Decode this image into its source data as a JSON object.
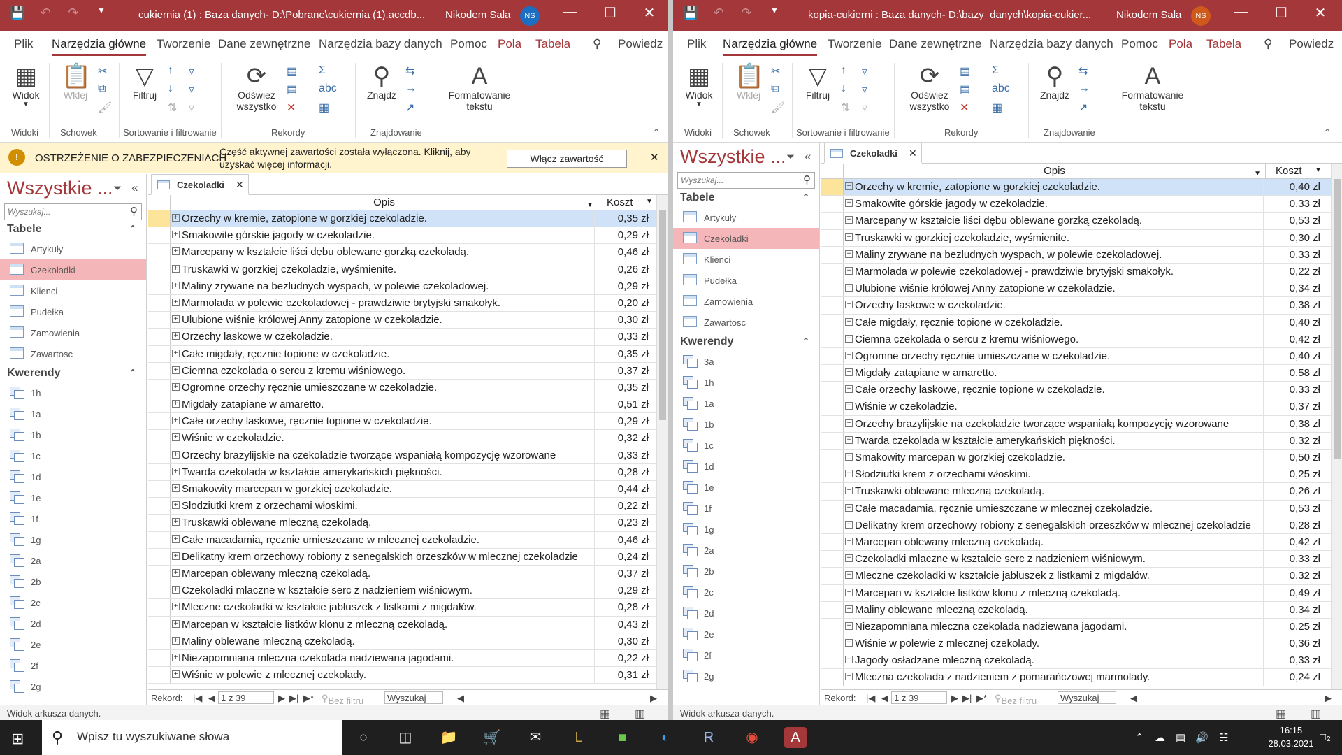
{
  "left": {
    "title": "cukiernia (1) : Baza danych- D:\\Pobrane\\cukiernia (1).accdb...",
    "user": "Nikodem Sala",
    "initials": "NS",
    "record_total": "1 z 39",
    "records": [
      [
        "Orzechy w kremie, zatopione w gorzkiej czekoladzie.",
        "0,35 zł"
      ],
      [
        "Smakowite górskie jagody w czekoladzie.",
        "0,29 zł"
      ],
      [
        "Marcepany w kształcie liści dębu oblewane gorzką czekoladą.",
        "0,46 zł"
      ],
      [
        "Truskawki w gorzkiej czekoladzie, wyśmienite.",
        "0,26 zł"
      ],
      [
        "Maliny zrywane na bezludnych wyspach, w polewie czekoladowej.",
        "0,29 zł"
      ],
      [
        "Marmolada w polewie czekoladowej - prawdziwie brytyjski smakołyk.",
        "0,20 zł"
      ],
      [
        "Ulubione wiśnie królowej Anny zatopione w czekoladzie.",
        "0,30 zł"
      ],
      [
        "Orzechy laskowe w czekoladzie.",
        "0,33 zł"
      ],
      [
        "Całe migdały, ręcznie topione w czekoladzie.",
        "0,35 zł"
      ],
      [
        "Ciemna czekolada o sercu z kremu wiśniowego.",
        "0,37 zł"
      ],
      [
        "Ogromne orzechy ręcznie umieszczane w czekoladzie.",
        "0,35 zł"
      ],
      [
        "Migdały zatapiane w amaretto.",
        "0,51 zł"
      ],
      [
        "Całe orzechy laskowe, ręcznie topione w czekoladzie.",
        "0,29 zł"
      ],
      [
        "Wiśnie w czekoladzie.",
        "0,32 zł"
      ],
      [
        "Orzechy brazylijskie na czekoladzie tworzące wspaniałą kompozycję wzorowane",
        "0,33 zł"
      ],
      [
        "Twarda czekolada w kształcie amerykańskich piękności.",
        "0,28 zł"
      ],
      [
        "Smakowity marcepan w gorzkiej czekoladzie.",
        "0,44 zł"
      ],
      [
        "Słodziutki krem z orzechami włoskimi.",
        "0,22 zł"
      ],
      [
        "Truskawki oblewane mleczną czekoladą.",
        "0,23 zł"
      ],
      [
        "Całe macadamia, ręcznie umieszczane w mlecznej czekoladzie.",
        "0,46 zł"
      ],
      [
        "Delikatny krem orzechowy robiony z senegalskich orzeszków w mlecznej czekoladzie",
        "0,24 zł"
      ],
      [
        "Marcepan oblewany mleczną czekoladą.",
        "0,37 zł"
      ],
      [
        "Czekoladki mlaczne w kształcie serc z nadzieniem wiśniowym.",
        "0,29 zł"
      ],
      [
        "Mleczne czekoladki w kształcie jabłuszek z listkami z migdałów.",
        "0,28 zł"
      ],
      [
        "Marcepan w kształcie listków klonu z mleczną czekoladą.",
        "0,43 zł"
      ],
      [
        "Maliny oblewane mleczną czekoladą.",
        "0,30 zł"
      ],
      [
        "Niezapomniana mleczna czekolada nadziewana jagodami.",
        "0,22 zł"
      ],
      [
        "Wiśnie w polewie z mlecznej czekolady.",
        "0,31 zł"
      ]
    ]
  },
  "right": {
    "title": "kopia-cukierni : Baza danych- D:\\bazy_danych\\kopia-cukier...",
    "user": "Nikodem Sala",
    "initials": "NS",
    "record_total": "1 z 39",
    "records": [
      [
        "Orzechy w kremie, zatopione w gorzkiej czekoladzie.",
        "0,40 zł"
      ],
      [
        "Smakowite górskie jagody w czekoladzie.",
        "0,33 zł"
      ],
      [
        "Marcepany w kształcie liści dębu oblewane gorzką czekoladą.",
        "0,53 zł"
      ],
      [
        "Truskawki w gorzkiej czekoladzie, wyśmienite.",
        "0,30 zł"
      ],
      [
        "Maliny zrywane na bezludnych wyspach, w polewie czekoladowej.",
        "0,33 zł"
      ],
      [
        "Marmolada w polewie czekoladowej - prawdziwie brytyjski smakołyk.",
        "0,22 zł"
      ],
      [
        "Ulubione wiśnie królowej Anny zatopione w czekoladzie.",
        "0,34 zł"
      ],
      [
        "Orzechy laskowe w czekoladzie.",
        "0,38 zł"
      ],
      [
        "Całe migdały, ręcznie topione w czekoladzie.",
        "0,40 zł"
      ],
      [
        "Ciemna czekolada o sercu z kremu wiśniowego.",
        "0,42 zł"
      ],
      [
        "Ogromne orzechy ręcznie umieszczane w czekoladzie.",
        "0,40 zł"
      ],
      [
        "Migdały zatapiane w amaretto.",
        "0,58 zł"
      ],
      [
        "Całe orzechy laskowe, ręcznie topione w czekoladzie.",
        "0,33 zł"
      ],
      [
        "Wiśnie w czekoladzie.",
        "0,37 zł"
      ],
      [
        "Orzechy brazylijskie na czekoladzie tworzące wspaniałą kompozycję wzorowane",
        "0,38 zł"
      ],
      [
        "Twarda czekolada w kształcie amerykańskich piękności.",
        "0,32 zł"
      ],
      [
        "Smakowity marcepan w gorzkiej czekoladzie.",
        "0,50 zł"
      ],
      [
        "Słodziutki krem z orzechami włoskimi.",
        "0,25 zł"
      ],
      [
        "Truskawki oblewane mleczną czekoladą.",
        "0,26 zł"
      ],
      [
        "Całe macadamia, ręcznie umieszczane w mlecznej czekoladzie.",
        "0,53 zł"
      ],
      [
        "Delikatny krem orzechowy robiony z senegalskich orzeszków w mlecznej czekoladzie",
        "0,28 zł"
      ],
      [
        "Marcepan oblewany mleczną czekoladą.",
        "0,42 zł"
      ],
      [
        "Czekoladki mlaczne w kształcie serc z nadzieniem wiśniowym.",
        "0,33 zł"
      ],
      [
        "Mleczne czekoladki w kształcie jabłuszek z listkami z migdałów.",
        "0,32 zł"
      ],
      [
        "Marcepan w kształcie listków klonu z mleczną czekoladą.",
        "0,49 zł"
      ],
      [
        "Maliny oblewane mleczną czekoladą.",
        "0,34 zł"
      ],
      [
        "Niezapomniana mleczna czekolada nadziewana jagodami.",
        "0,25 zł"
      ],
      [
        "Wiśnie w polewie z mlecznej czekolady.",
        "0,36 zł"
      ],
      [
        "Jagody osładzane mleczną czekoladą.",
        "0,33 zł"
      ],
      [
        "Mleczna czekolada z nadzieniem z pomarańczowej marmolady.",
        "0,24 zł"
      ]
    ]
  },
  "ribbon_tabs": [
    "Plik",
    "Narzędzia główne",
    "Tworzenie",
    "Dane zewnętrzne",
    "Narzędzia bazy danych",
    "Pomoc",
    "Pola",
    "Tabela",
    "Powiedz"
  ],
  "ribbon": {
    "widok": "Widok",
    "wklej": "Wklej",
    "filtruj": "Filtruj",
    "odswiez_1": "Odśwież",
    "odswiez_2": "wszystko",
    "znajdz": "Znajdź",
    "format_1": "Formatowanie",
    "format_2": "tekstu",
    "groups": [
      "Widoki",
      "Schowek",
      "Sortowanie i filtrowanie",
      "Rekordy",
      "Znajdowanie"
    ]
  },
  "warning": {
    "title": "OSTRZEŻENIE O ZABEZPIECZENIACH",
    "message": "Część aktywnej zawartości została wyłączona. Kliknij, aby uzyskać więcej informacji.",
    "button": "Włącz zawartość"
  },
  "nav": {
    "title": "Wszystkie ...",
    "search_placeholder": "Wyszukaj...",
    "tables_header": "Tabele",
    "queries_header": "Kwerendy",
    "tables": [
      "Artykuły",
      "Czekoladki",
      "Klienci",
      "Pudełka",
      "Zamowienia",
      "Zawartosc"
    ],
    "queries_left": [
      "1h",
      "1a",
      "1b",
      "1c",
      "1d",
      "1e",
      "1f",
      "1g",
      "2a",
      "2b",
      "2c",
      "2d",
      "2e",
      "2f",
      "2g"
    ],
    "queries_right": [
      "3a",
      "1h",
      "1a",
      "1b",
      "1c",
      "1d",
      "1e",
      "1f",
      "1g",
      "2a",
      "2b",
      "2c",
      "2d",
      "2e",
      "2f",
      "2g"
    ]
  },
  "doc": {
    "tab": "Czekoladki",
    "col_opis": "Opis",
    "col_koszt": "Koszt"
  },
  "recnav": {
    "rekord": "Rekord:",
    "nofilter": "Bez filtru",
    "search": "Wyszukaj"
  },
  "status": "Widok arkusza danych.",
  "taskbar": {
    "search": "Wpisz tu wyszukiwane słowa",
    "time": "16:15",
    "date": "28.03.2021",
    "notif": "2"
  },
  "colors": {
    "access_red": "#a4373a",
    "warning_bg": "#fff4ce",
    "selected_row": "#cfe2f7",
    "nav_selected": "#f4b6b8"
  }
}
